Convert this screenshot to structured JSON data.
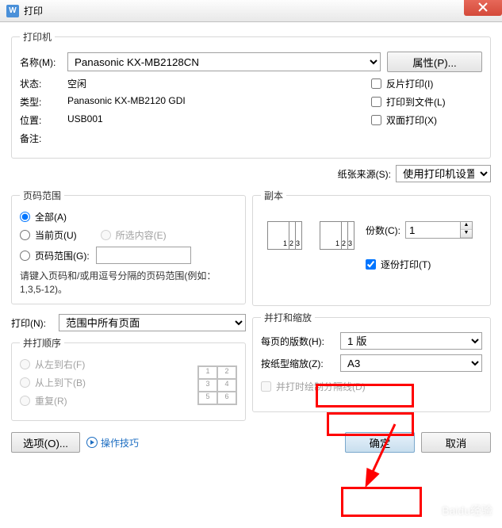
{
  "window": {
    "title": "打印",
    "icon": "W"
  },
  "printer": {
    "legend": "打印机",
    "nameLabel": "名称(M):",
    "nameValue": "Panasonic KX-MB2128CN",
    "propertiesBtn": "属性(P)...",
    "statusLabel": "状态:",
    "statusValue": "空闲",
    "typeLabel": "类型:",
    "typeValue": "Panasonic KX-MB2120 GDI",
    "locationLabel": "位置:",
    "locationValue": "USB001",
    "commentLabel": "备注:",
    "commentValue": "",
    "reversePrint": "反片打印(I)",
    "printToFile": "打印到文件(L)",
    "duplex": "双面打印(X)"
  },
  "paperSource": {
    "label": "纸张来源(S):",
    "value": "使用打印机设置"
  },
  "pageRange": {
    "legend": "页码范围",
    "all": "全部(A)",
    "current": "当前页(U)",
    "selection": "所选内容(E)",
    "pages": "页码范围(G):",
    "hint": "请键入页码和/或用逗号分隔的页码范围(例如：1,3,5-12)。"
  },
  "copies": {
    "legend": "副本",
    "countLabel": "份数(C):",
    "countValue": "1",
    "collate": "逐份打印(T)"
  },
  "printWhat": {
    "label": "打印(N):",
    "value": "范围中所有页面"
  },
  "printOrder": {
    "legend": "并打顺序",
    "leftRight": "从左到右(F)",
    "topBottom": "从上到下(B)",
    "repeat": "重复(R)"
  },
  "scaling": {
    "legend": "并打和缩放",
    "pagesPerSheetLabel": "每页的版数(H):",
    "pagesPerSheetValue": "1 版",
    "scaleToLabel": "按纸型缩放(Z):",
    "scaleToValue": "A3",
    "drawLines": "并打时绘制分隔线(D)"
  },
  "buttons": {
    "options": "选项(O)...",
    "tips": "操作技巧",
    "ok": "确定",
    "cancel": "取消"
  },
  "watermark": "Baidu经验"
}
